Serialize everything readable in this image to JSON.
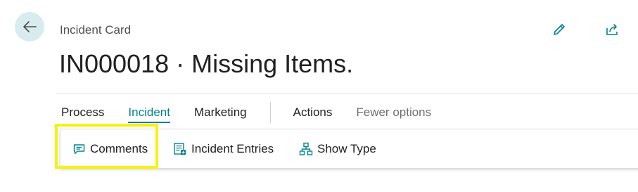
{
  "header": {
    "caption": "Incident Card",
    "title": "IN000018 · Missing Items."
  },
  "action_menu": {
    "items": [
      {
        "label": "Process"
      },
      {
        "label": "Incident",
        "active": true
      },
      {
        "label": "Marketing"
      },
      {
        "label": "Actions"
      },
      {
        "label": "Fewer options"
      }
    ]
  },
  "sub_actions": [
    {
      "label": "Comments",
      "icon": "comment-icon"
    },
    {
      "label": "Incident Entries",
      "icon": "entries-icon"
    },
    {
      "label": "Show Type",
      "icon": "hierarchy-icon"
    }
  ],
  "colors": {
    "accent": "#00838f",
    "back_circle": "#d8ecef",
    "highlight": "#f7f20f"
  }
}
